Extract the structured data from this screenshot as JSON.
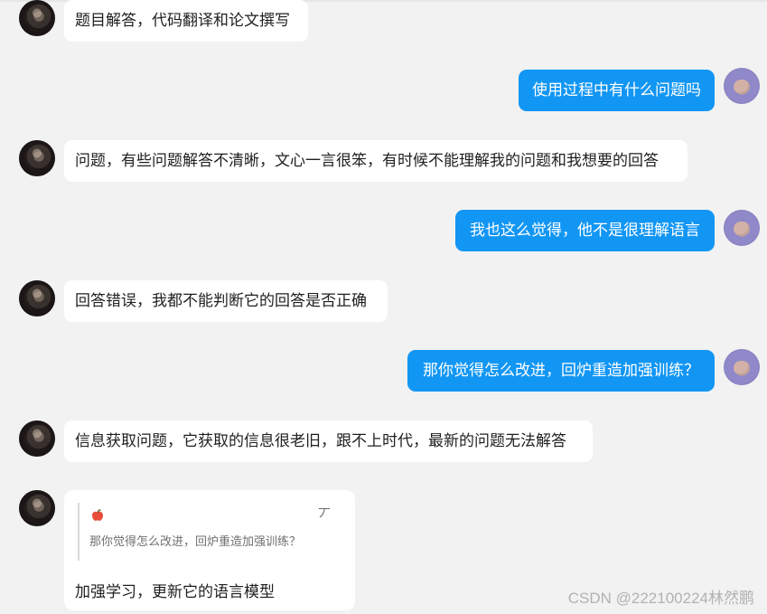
{
  "messages": [
    {
      "side": "left",
      "text": "题目解答，代码翻译和论文撰写"
    },
    {
      "side": "right",
      "text": "使用过程中有什么问题吗"
    },
    {
      "side": "left",
      "text": "问题，有些问题解答不清晰，文心一言很笨，有时候不能理解我的问题和我想要的回答"
    },
    {
      "side": "right",
      "text": "我也这么觉得，他不是很理解语言"
    },
    {
      "side": "left",
      "text": "回答错误，我都不能判断它的回答是否正确"
    },
    {
      "side": "right",
      "text": "那你觉得怎么改进，回炉重造加强训练？"
    },
    {
      "side": "left",
      "text": "信息获取问题，它获取的信息很老旧，跟不上时代，最新的问题无法解答"
    }
  ],
  "quoted_reply": {
    "quote_text": "那你觉得怎么改进，回炉重造加强训练？",
    "reply_text": "加强学习，更新它的语言模型",
    "action_glyph": "丆"
  },
  "watermark": "CSDN @222100224林然鹏",
  "icons": {
    "left_avatar": "user-avatar-dark",
    "right_avatar": "user-avatar-purple",
    "apple": "apple-icon",
    "copy": "copy-icon"
  },
  "colors": {
    "background": "#f2f2f2",
    "left_bubble": "#ffffff",
    "right_bubble": "#1296f4",
    "text_dark": "#1f1f1f",
    "quote_text": "#6f6f6f",
    "watermark": "#b2b2b2"
  }
}
